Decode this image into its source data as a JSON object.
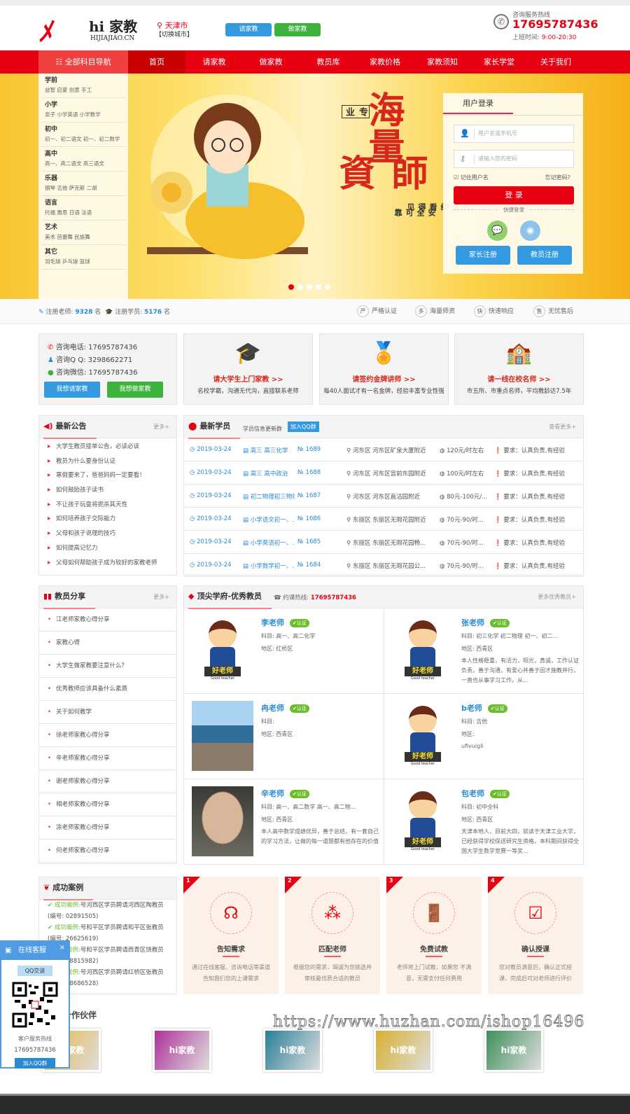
{
  "header": {
    "logo_title": "hi 家教",
    "logo_sub": "HIJIAJIAO.CN",
    "city": "天津市",
    "switch_city": "【切换城市】",
    "btn_hire": "请家教",
    "btn_teach": "做家教",
    "hotline_label": "咨询服务热线",
    "hotline": "17695787436",
    "hours_label": "上班时间:",
    "hours": "9:00-20:30"
  },
  "nav": {
    "all": "全部科目导航",
    "items": [
      "首页",
      "请家教",
      "做家教",
      "教员库",
      "家教价格",
      "家教须知",
      "家长学堂",
      "关于我们"
    ]
  },
  "sidebar": [
    {
      "h": "学前",
      "s": "益智  启蒙  创意  手工"
    },
    {
      "h": "小学",
      "s": "亲子  小学英语  小学数学"
    },
    {
      "h": "初中",
      "s": "初一、初二语文  初一、初二数学"
    },
    {
      "h": "高中",
      "s": "高一、高二语文  高三语文"
    },
    {
      "h": "乐器",
      "s": "钢琴  吉他  萨克斯  二胡"
    },
    {
      "h": "语言",
      "s": "托福  雅思  日语  法语"
    },
    {
      "h": "艺术",
      "s": "美术  芭蕾舞  民族舞"
    },
    {
      "h": "其它",
      "s": "羽毛球  乒乓球  篮球"
    }
  ],
  "banner": {
    "big1": "海量",
    "big2": "師資",
    "tag": "专业",
    "small1": "安全可靠",
    "small2": "好成绩看得见",
    "slides": 5,
    "active_slide": 1
  },
  "login": {
    "tab": "用户登录",
    "user_ph": "用户名或手机号",
    "pass_ph": "请输入您的密码",
    "remember": "记住用户名",
    "forgot": "忘记密码?",
    "submit": "登 录",
    "quick": "快捷登录",
    "reg_parent": "家长注册",
    "reg_teacher": "教员注册"
  },
  "stats": {
    "teachers_label": "注册老师:",
    "teachers": "9328",
    "students_label": "注册学员:",
    "students": "5176",
    "unit": "名",
    "badges": [
      {
        "i": "严",
        "t": "严格认证"
      },
      {
        "i": "多",
        "t": "海量师资"
      },
      {
        "i": "快",
        "t": "快速响应"
      },
      {
        "i": "售",
        "t": "无忧售后"
      }
    ]
  },
  "contact": {
    "phone": "咨询电话:  17695787436",
    "qq": "咨询Q Q:  3298662271",
    "wechat": "咨询微信:  17695787436",
    "btn_hire": "我想请家教",
    "btn_teach": "我想做家教"
  },
  "features": [
    {
      "t": "请大学生上门家教 >>",
      "d": "名校学霸，沟通无代沟，直接联系老师"
    },
    {
      "t": "请签约金牌讲师 >>",
      "d": "每40人面试才有一名金牌，经验丰富专业性强"
    },
    {
      "t": "请一线在校名师 >>",
      "d": "市五所、市重点名师，平均教龄达7.5年"
    }
  ],
  "notice": {
    "title": "最新公告",
    "more": "更多+",
    "items": [
      "大学生教员接单公告，必读必读",
      "教员为什么要身份认证",
      "寒假要来了，爸爸妈妈一定要看！",
      "如何鼓励孩子读书",
      "不让孩子玩耍将扼杀其天性",
      "如何培养孩子交际能力",
      "父母和孩子说理的技巧",
      "如何提高记忆力",
      "父母如何帮助孩子成为较好的家教老师"
    ]
  },
  "students": {
    "title": "最新学员",
    "sub": "学员信息更新群",
    "qq_btn": "加入QQ群",
    "more": "查看更多+",
    "rows": [
      {
        "date": "2019-03-24",
        "subject": "高三 高三化学",
        "no": "1689",
        "area": "河东区 河东区矿泉大厦附近",
        "price": "120元/时左右",
        "req": "要求：认真负责,有经验"
      },
      {
        "date": "2019-03-24",
        "subject": "高三 高中政治",
        "no": "1688",
        "area": "河东区 河东区宫前东园附近",
        "price": "100元/时左右",
        "req": "要求：认真负责,有经验"
      },
      {
        "date": "2019-03-24",
        "subject": "初二物理初三物理",
        "no": "1687",
        "area": "河东区 河东区直沽园附近",
        "price": "80元-100元/...",
        "req": "要求：认真负责,有经验"
      },
      {
        "date": "2019-03-24",
        "subject": "小学语文初一、...",
        "no": "1686",
        "area": "东丽区 东丽区无瑕花园附近",
        "price": "70元-90/时...",
        "req": "要求：认真负责,有经验"
      },
      {
        "date": "2019-03-24",
        "subject": "小学英语初一、...",
        "no": "1685",
        "area": "东丽区 东丽区无瑕花园畅...",
        "price": "70元-90/时...",
        "req": "要求：认真负责,有经验"
      },
      {
        "date": "2019-03-24",
        "subject": "小学数学初一、...",
        "no": "1684",
        "area": "东丽区 东丽区无瑕花园公...",
        "price": "70元-90/时...",
        "req": "要求：认真负责,有经验"
      }
    ]
  },
  "share": {
    "title": "教员分享",
    "more": "更多+",
    "items": [
      "江老师家教心得分享",
      "家教心得",
      "大学生做家教要注意什么?",
      "优秀教师应该具备什么素质",
      "关于如何教学",
      "徐老师家教心得分享",
      "辛老师家教心得分享",
      "谢老师家教心得分享",
      "相老师家教心得分享",
      "涂老师家教心得分享",
      "何老师家教心得分享"
    ]
  },
  "teachers": {
    "title": "顶尖学府-优秀教员",
    "hot_label": "约课热线:",
    "hot": "17695787436",
    "more": "更多优秀教员+",
    "badge": "认证",
    "cartoon_label": "好老师",
    "cartoon_sub": "Good teacher",
    "list": [
      {
        "name": "李老师",
        "subject": "科目:  高一、高二化学",
        "area": "地区: 红桥区",
        "desc": "",
        "photo": "cartoon"
      },
      {
        "name": "张老师",
        "subject": "科目:  初三化学 初二物理 初一、初二...",
        "area": "地区: 西青区",
        "desc": "本人性格稳重，有活力，阳光，真诚，工作认证负责，善于沟通，有爱心并善于因才施教并行，一直也从事学习工作。从...",
        "photo": "cartoon"
      },
      {
        "name": "冉老师",
        "subject": "科目:",
        "area": "地区: 西青区",
        "desc": "",
        "photo": "sea"
      },
      {
        "name": "b老师",
        "subject": "科目:  吉他",
        "area": "地区:",
        "desc": "ufivuigli",
        "photo": "cartoon"
      },
      {
        "name": "辛老师",
        "subject": "科目:  高一、高二数学 高一、高二物...",
        "area": "地区: 西青区",
        "desc": "本人高中数学成绩优异，善于总结，有一套自己的学习方法，让做的每一道题都有他存在的价值",
        "photo": "man"
      },
      {
        "name": "包老师",
        "subject": "科目:  初中全科",
        "area": "地区: 西青区",
        "desc": "天津本地人，目前大四，就读于天津工业大学，已经获得学校保送研究生资格，本科期间获得全国大学生数学竞赛一等奖...",
        "photo": "cartoon"
      }
    ]
  },
  "cases": {
    "title": "成功案例",
    "label": "成功案例:",
    "items": [
      "号河西区学员聘请河西区陶教员(编号: 02891505)",
      "号和平区学员聘请和平区张教员(编号: 26625619)",
      "号和平区学员聘请西青区饶教员(编号: 88815982)",
      "号河西区学员聘请红桥区张教员(编号: 88686528)"
    ]
  },
  "steps": [
    {
      "n": "1",
      "t": "告知需求",
      "d": "通过在线客服、咨询电话等渠道告知我们您的上课需求"
    },
    {
      "n": "2",
      "t": "匹配老师",
      "d": "根据您的需求，竭诚为您挑选并审核最优质合适的教员"
    },
    {
      "n": "3",
      "t": "免费试教",
      "d": "老师将上门试教，如果您 不满意，无需支付任何费用"
    },
    {
      "n": "4",
      "t": "确认授课",
      "d": "您对教员满意后，确认正式授课，完成后可对老师进行评价"
    }
  ],
  "partners": {
    "title": "合作伙伴",
    "label": "hi家教",
    "colors": [
      "#e8b640",
      "#b0309a",
      "#2a7f98",
      "#d8b030",
      "#3f8f5a"
    ]
  },
  "kefu": {
    "title": "在线客服",
    "qq": "QQ交谈",
    "hotline_label": "客户服务热线",
    "hotline": "17695787436",
    "qq_group": "加入QQ群"
  },
  "watermark": "https://www.huzhan.com/ishop16496",
  "colors": {
    "brand": "#e60012",
    "blue": "#2a8ad4",
    "green": "#3db33d"
  }
}
